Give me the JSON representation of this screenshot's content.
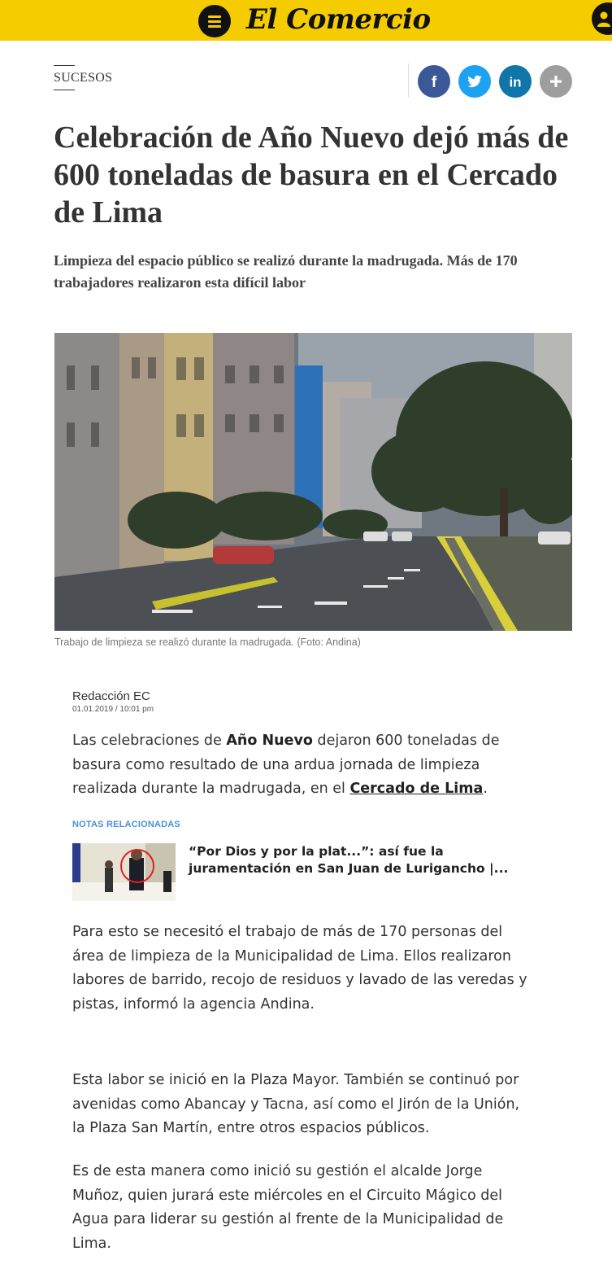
{
  "header": {
    "logo_text": "El Comercio",
    "menu_icon": "hamburger-menu-icon",
    "user_icon": "user-icon",
    "bar_color": "#f5cc00"
  },
  "article": {
    "section": "SUCESOS",
    "social": [
      {
        "name": "facebook",
        "glyph": "f",
        "color": "#3b5998"
      },
      {
        "name": "twitter",
        "color": "#1da1f2"
      },
      {
        "name": "linkedin",
        "glyph": "in",
        "color": "#0e76a8"
      },
      {
        "name": "more",
        "glyph": "+",
        "color": "#9e9e9e"
      }
    ],
    "headline": "Celebración de Año Nuevo dejó más de 600 toneladas de basura en el Cercado de Lima",
    "dek": "Limpieza del espacio público se realizó durante la madrugada. Más de 170 trabajadores realizaron esta difícil labor",
    "image_caption": "Trabajo de limpieza se realizó durante la madrugada. (Foto: Andina)",
    "author": "Redacción EC",
    "date": "01.01.2019 / 10:01 pm",
    "p1": {
      "t1": "Las celebraciones de ",
      "b1": "Año Nuevo",
      "t2": " dejaron 600 toneladas de basura como resultado de una ardua jornada de limpieza realizada durante la madrugada, en el ",
      "link": "Cercado de Lima",
      "t3": "."
    },
    "related": {
      "label": "NOTAS RELACIONADAS",
      "title": "“Por Dios y por la plat...”: así fue la juramentación en San Juan de Lurigancho |..."
    },
    "p2": "Para esto se necesitó el trabajo de más de 170 personas del área de limpieza de la Municipalidad de Lima. Ellos realizaron labores de barrido, recojo de residuos y lavado de las veredas y pistas, informó la agencia Andina.",
    "p3": "Esta labor se inició en la Plaza Mayor. También se continuó por avenidas como Abancay y Tacna, así como el Jirón de la Unión, la Plaza San Martín, entre otros espacios públicos.",
    "p4": "Es de esta manera como inició su gestión el alcalde Jorge Muñoz, quien jurará este miércoles en el Circuito Mágico del Agua para liderar su gestión al frente de la Municipalidad de Lima."
  }
}
